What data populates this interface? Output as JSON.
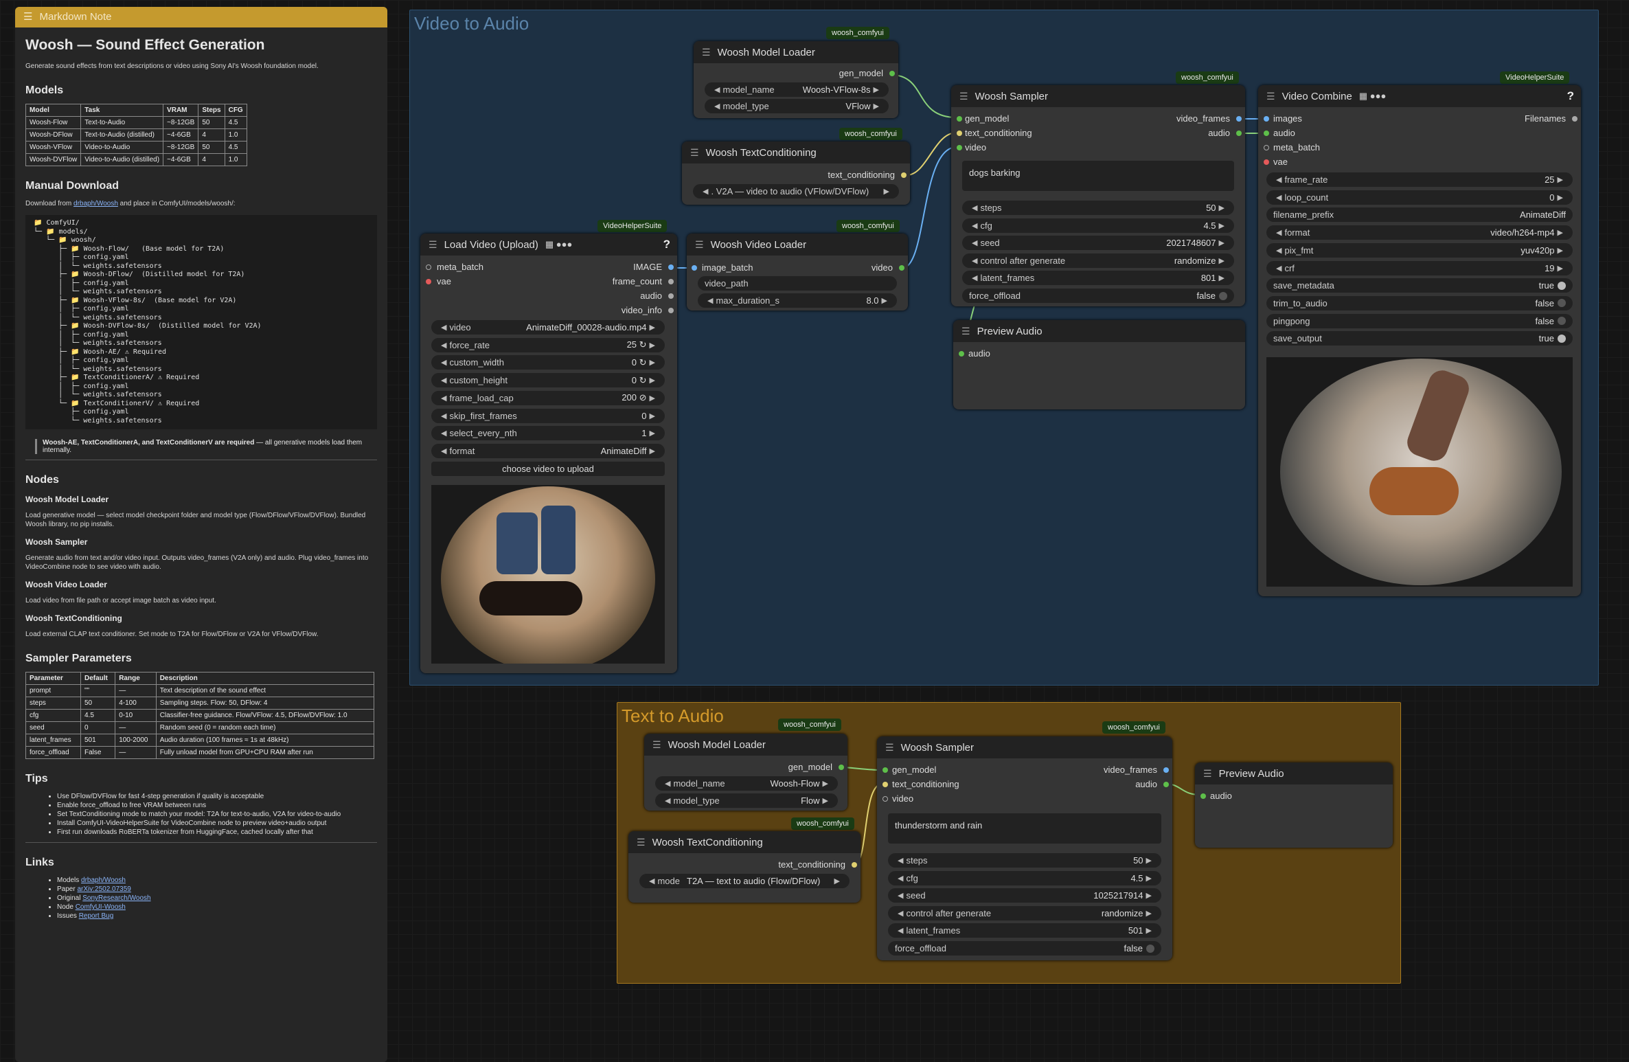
{
  "note": {
    "header": "Markdown Note",
    "title": "Woosh — Sound Effect Generation",
    "intro": "Generate sound effects from text descriptions or video using Sony AI's Woosh foundation model.",
    "models_heading": "Models",
    "models_cols": [
      "Model",
      "Task",
      "VRAM",
      "Steps",
      "CFG"
    ],
    "models_rows": [
      [
        "Woosh-Flow",
        "Text-to-Audio",
        "~8-12GB",
        "50",
        "4.5"
      ],
      [
        "Woosh-DFlow",
        "Text-to-Audio (distilled)",
        "~4-6GB",
        "4",
        "1.0"
      ],
      [
        "Woosh-VFlow",
        "Video-to-Audio",
        "~8-12GB",
        "50",
        "4.5"
      ],
      [
        "Woosh-DVFlow",
        "Video-to-Audio (distilled)",
        "~4-6GB",
        "4",
        "1.0"
      ]
    ],
    "manual_heading": "Manual Download",
    "manual_pre": "Download from ",
    "manual_link": "drbaph/Woosh",
    "manual_post": " and place in ComfyUI/models/woosh/:",
    "tree": "📁 ComfyUI/\n└─ 📁 models/\n   └─ 📁 woosh/\n      ├─ 📁 Woosh-Flow/   (Base model for T2A)\n      │  ├─ config.yaml\n      │  └─ weights.safetensors\n      ├─ 📁 Woosh-DFlow/  (Distilled model for T2A)\n      │  ├─ config.yaml\n      │  └─ weights.safetensors\n      ├─ 📁 Woosh-VFlow-8s/  (Base model for V2A)\n      │  ├─ config.yaml\n      │  └─ weights.safetensors\n      ├─ 📁 Woosh-DVFlow-8s/  (Distilled model for V2A)\n      │  ├─ config.yaml\n      │  └─ weights.safetensors\n      ├─ 📁 Woosh-AE/ ⚠ Required\n      │  ├─ config.yaml\n      │  └─ weights.safetensors\n      ├─ 📁 TextConditionerA/ ⚠ Required\n      │  ├─ config.yaml\n      │  └─ weights.safetensors\n      └─ 📁 TextConditionerV/ ⚠ Required\n         ├─ config.yaml\n         └─ weights.safetensors",
    "required_bold": "Woosh-AE, TextConditionerA, and TextConditionerV are required",
    "required_rest": " — all generative models load them internally.",
    "nodes_heading": "Nodes",
    "nodes": [
      {
        "name": "Woosh Model Loader",
        "desc": "Load generative model — select model checkpoint folder and model type (Flow/DFlow/VFlow/DVFlow). Bundled Woosh library, no pip installs."
      },
      {
        "name": "Woosh Sampler",
        "desc": "Generate audio from text and/or video input. Outputs video_frames (V2A only) and audio. Plug video_frames into VideoCombine node to see video with audio."
      },
      {
        "name": "Woosh Video Loader",
        "desc": "Load video from file path or accept image batch as video input."
      },
      {
        "name": "Woosh TextConditioning",
        "desc": "Load external CLAP text conditioner. Set mode to T2A for Flow/DFlow or V2A for VFlow/DVFlow."
      }
    ],
    "sampler_heading": "Sampler Parameters",
    "sampler_cols": [
      "Parameter",
      "Default",
      "Range",
      "Description"
    ],
    "sampler_rows": [
      [
        "prompt",
        "\"\"",
        "—",
        "Text description of the sound effect"
      ],
      [
        "steps",
        "50",
        "4-100",
        "Sampling steps. Flow: 50, DFlow: 4"
      ],
      [
        "cfg",
        "4.5",
        "0-10",
        "Classifier-free guidance. Flow/VFlow: 4.5, DFlow/DVFlow: 1.0"
      ],
      [
        "seed",
        "0",
        "—",
        "Random seed (0 = random each time)"
      ],
      [
        "latent_frames",
        "501",
        "100-2000",
        "Audio duration (100 frames ≈ 1s at 48kHz)"
      ],
      [
        "force_offload",
        "False",
        "—",
        "Fully unload model from GPU+CPU RAM after run"
      ]
    ],
    "tips_heading": "Tips",
    "tips": [
      "Use DFlow/DVFlow for fast 4-step generation if quality is acceptable",
      "Enable force_offload to free VRAM between runs",
      "Set TextConditioning mode to match your model: T2A for text-to-audio, V2A for video-to-audio",
      "Install ComfyUI-VideoHelperSuite for VideoCombine node to preview video+audio output",
      "First run downloads RoBERTa tokenizer from HuggingFace, cached locally after that"
    ],
    "links_heading": "Links",
    "links": [
      [
        "Models ",
        "drbaph/Woosh"
      ],
      [
        "Paper ",
        "arXiv:2502.07359"
      ],
      [
        "Original ",
        "SonyResearch/Woosh"
      ],
      [
        "Node ",
        "ComfyUI-Woosh"
      ],
      [
        "Issues ",
        "Report Bug"
      ]
    ]
  },
  "groups": {
    "v2a": "Video to Audio",
    "t2a": "Text to Audio"
  },
  "badges": {
    "woosh": "woosh_comfyui",
    "vhs": "VideoHelperSuite"
  },
  "v2a": {
    "loader": {
      "title": "Woosh Model Loader",
      "out": "gen_model",
      "model_name_l": "model_name",
      "model_name_v": "Woosh-VFlow-8s",
      "model_type_l": "model_type",
      "model_type_v": "VFlow"
    },
    "textcond": {
      "title": "Woosh TextConditioning",
      "out": "text_conditioning",
      "mode_v": ". V2A — video to audio (VFlow/DVFlow)"
    },
    "videoloader": {
      "title": "Woosh Video Loader",
      "in": "image_batch",
      "out": "video",
      "path": "video_path",
      "dur_l": "max_duration_s",
      "dur_v": "8.0"
    },
    "loadvideo": {
      "title": "Load Video (Upload)",
      "in1": "meta_batch",
      "in2": "vae",
      "out1": "IMAGE",
      "out2": "frame_count",
      "out3": "audio",
      "out4": "video_info",
      "w": [
        [
          "video",
          "AnimateDiff_00028-audio.mp4"
        ],
        [
          "force_rate",
          "25 ↻"
        ],
        [
          "custom_width",
          "0 ↻"
        ],
        [
          "custom_height",
          "0 ↻"
        ],
        [
          "frame_load_cap",
          "200 ⊘"
        ],
        [
          "skip_first_frames",
          "0"
        ],
        [
          "select_every_nth",
          "1"
        ],
        [
          "format",
          "AnimateDiff"
        ]
      ],
      "upload": "choose video to upload"
    },
    "sampler": {
      "title": "Woosh Sampler",
      "in1": "gen_model",
      "in2": "text_conditioning",
      "in3": "video",
      "out1": "video_frames",
      "out2": "audio",
      "prompt": "dogs barking",
      "w": [
        [
          "steps",
          "50"
        ],
        [
          "cfg",
          "4.5"
        ],
        [
          "seed",
          "2021748607"
        ],
        [
          "control after generate",
          "randomize"
        ],
        [
          "latent_frames",
          "801"
        ]
      ],
      "fo_l": "force_offload",
      "fo_v": "false"
    },
    "preview": {
      "title": "Preview Audio",
      "in": "audio"
    },
    "combine": {
      "title": "Video Combine",
      "in1": "images",
      "in2": "audio",
      "in3": "meta_batch",
      "in4": "vae",
      "out": "Filenames",
      "w": [
        [
          "frame_rate",
          "25"
        ],
        [
          "loop_count",
          "0"
        ]
      ],
      "prefix_l": "filename_prefix",
      "prefix_v": "AnimateDiff",
      "w2": [
        [
          "format",
          "video/h264-mp4"
        ],
        [
          "pix_fmt",
          "yuv420p"
        ],
        [
          "crf",
          "19"
        ]
      ],
      "t": [
        [
          "save_metadata",
          "true"
        ],
        [
          "trim_to_audio",
          "false"
        ],
        [
          "pingpong",
          "false"
        ],
        [
          "save_output",
          "true"
        ]
      ]
    }
  },
  "t2a": {
    "loader": {
      "title": "Woosh Model Loader",
      "out": "gen_model",
      "model_name_l": "model_name",
      "model_name_v": "Woosh-Flow",
      "model_type_l": "model_type",
      "model_type_v": "Flow"
    },
    "textcond": {
      "title": "Woosh TextConditioning",
      "out": "text_conditioning",
      "mode_l": "mode",
      "mode_v": "T2A — text to audio (Flow/DFlow)"
    },
    "sampler": {
      "title": "Woosh Sampler",
      "in1": "gen_model",
      "in2": "text_conditioning",
      "in3": "video",
      "out1": "video_frames",
      "out2": "audio",
      "prompt": "thunderstorm and rain",
      "w": [
        [
          "steps",
          "50"
        ],
        [
          "cfg",
          "4.5"
        ],
        [
          "seed",
          "1025217914"
        ],
        [
          "control after generate",
          "randomize"
        ],
        [
          "latent_frames",
          "501"
        ]
      ],
      "fo_l": "force_offload",
      "fo_v": "false"
    },
    "preview": {
      "title": "Preview Audio",
      "in": "audio"
    }
  },
  "colors": {
    "model": "#5ebf4a",
    "cond": "#e0d070",
    "video": "#6ab0f3",
    "image": "#6ab0f3",
    "audio": "#5ebf4a",
    "vae": "#e55a5a"
  }
}
